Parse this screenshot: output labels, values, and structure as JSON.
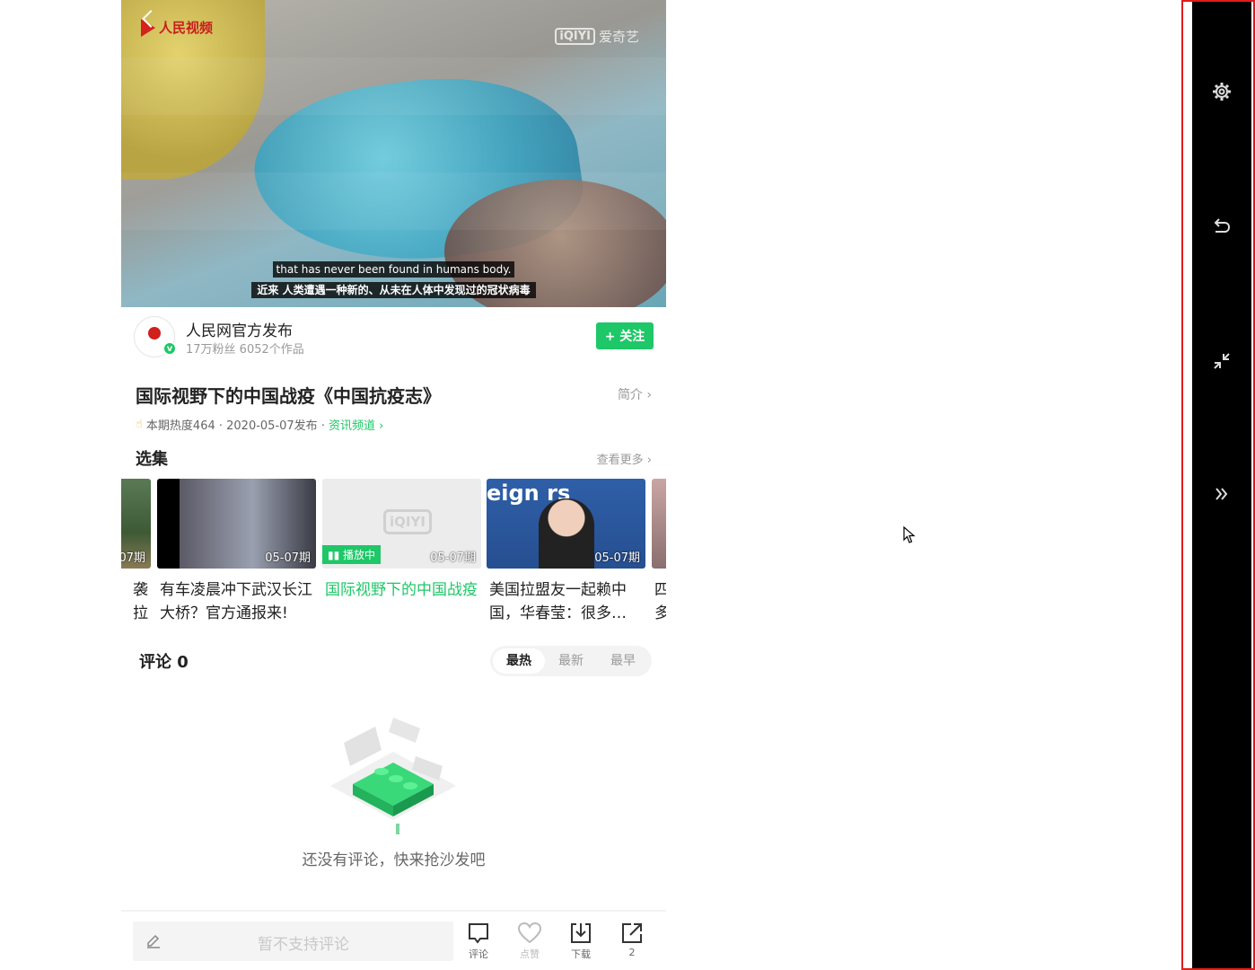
{
  "video": {
    "logo_text": "人民视频",
    "watermark_brand": "iQIYI",
    "watermark_text": "爱奇艺",
    "subtitle_en": "that has never been found in humans body.",
    "subtitle_cn": "近来 人类遭遇一种新的、从未在人体中发现过的冠状病毒"
  },
  "author": {
    "name": "人民网官方发布",
    "meta": "17万粉丝 6052个作品",
    "badge": "v",
    "follow_label": "+ 关注"
  },
  "content": {
    "title": "国际视野下的中国战疫《中国抗疫志》",
    "intro_label": "简介 ›",
    "meta_text": "本期热度464 · 2020-05-07发布 ·",
    "channel_label": "资讯频道 ›"
  },
  "episodes": {
    "section_title": "选集",
    "more_label": "查看更多 ›",
    "items": [
      {
        "date": "07期",
        "caption": "袭\n拉"
      },
      {
        "date": "05-07期",
        "caption": "有车凌晨冲下武汉长江大桥？官方通报来!"
      },
      {
        "date": "05-07期",
        "caption": "国际视野下的中国战疫",
        "playing": "播放中",
        "thumb_brand": "iQIYI"
      },
      {
        "date": "05-07期",
        "caption": "美国拉盟友一起赖中国，华春莹：很多…",
        "thumb_text": "eign   rs"
      },
      {
        "date": "",
        "caption": "四\n多"
      }
    ]
  },
  "comments": {
    "title": "评论 0",
    "tabs": [
      "最热",
      "最新",
      "最早"
    ],
    "active_tab": "最热",
    "empty_text": "还没有评论，快来抢沙发吧"
  },
  "bottom_bar": {
    "input_placeholder": "暂不支持评论",
    "actions": [
      {
        "label": "评论",
        "icon": "comment-icon"
      },
      {
        "label": "点赞",
        "icon": "heart-icon"
      },
      {
        "label": "下载",
        "icon": "download-icon"
      },
      {
        "label": "2",
        "icon": "share-icon"
      }
    ]
  },
  "side_panel": {
    "buttons": [
      "settings-icon",
      "undo-icon",
      "collapse-icon",
      "expand-chevrons-icon"
    ]
  },
  "colors": {
    "accent": "#1ec767",
    "side_frame": "#e21b1b",
    "side_panel": "#000000"
  }
}
